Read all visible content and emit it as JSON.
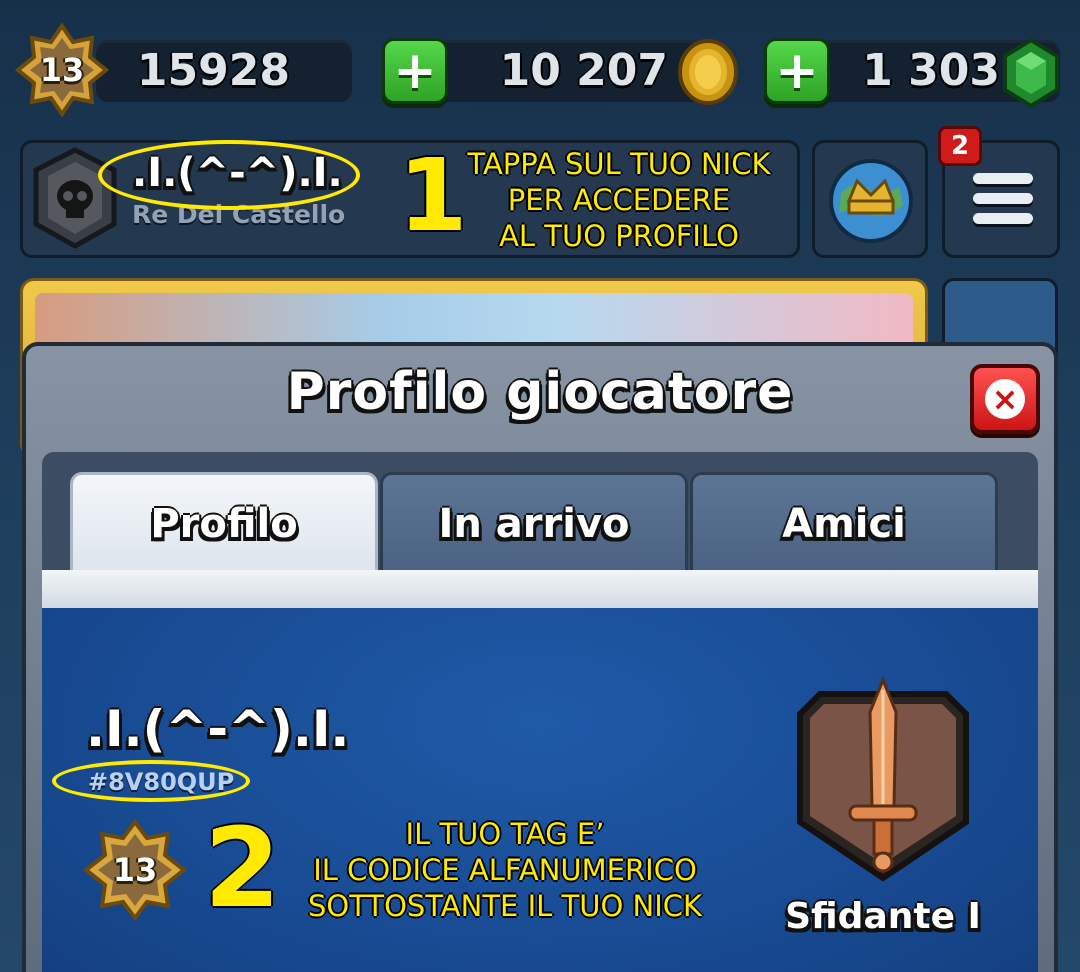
{
  "resources": {
    "level": "13",
    "trophies": "15928",
    "gold": "10 207",
    "gems": "1 303",
    "plus_label": "+"
  },
  "profile_bar": {
    "nickname": ".I.(^-^).I.",
    "subtitle": "Re Del Castello",
    "notification_count": "2"
  },
  "annotations": {
    "step1_number": "1",
    "step1_lines": [
      "TAPPA SUL TUO NICK",
      "PER ACCEDERE",
      "AL TUO PROFILO"
    ],
    "step2_number": "2",
    "step2_lines": [
      "IL TUO TAG E’",
      "IL CODICE ALFANUMERICO",
      "SOTTOSTANTE IL TUO NICK"
    ],
    "color": "#ffea00"
  },
  "modal": {
    "title": "Profilo giocatore",
    "close_icon": "close-icon",
    "tabs": [
      {
        "label": "Profilo",
        "active": true
      },
      {
        "label": "In arrivo",
        "active": false
      },
      {
        "label": "Amici",
        "active": false
      }
    ]
  },
  "player": {
    "nickname": ".I.(^-^).I.",
    "tag": "#8V80QUP",
    "level": "13",
    "arena": "Sfidante I"
  },
  "icons": {
    "level": "level-star-icon",
    "gold": "gold-coin-icon",
    "gem": "gem-icon",
    "clan": "skull-shield-icon",
    "globe": "globe-crown-icon",
    "menu": "hamburger-menu-icon",
    "arena": "sword-badge-icon"
  }
}
